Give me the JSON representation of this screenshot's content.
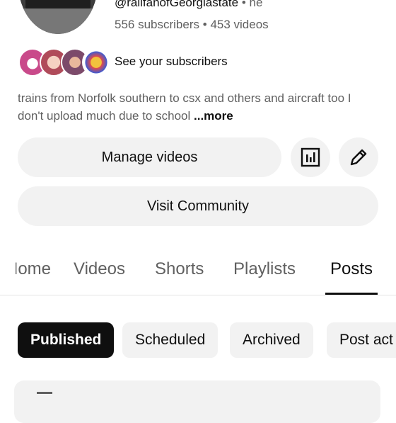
{
  "channel": {
    "handle": "@railfanofGeorgiastate",
    "handle_suffix": "he",
    "subscribers": "556 subscribers",
    "videos": "453 videos",
    "stats_separator": "•"
  },
  "subscribers_link": "See your subscribers",
  "description": {
    "text": "trains from Norfolk southern to csx and others and aircraft too I don't upload much due to school",
    "more_label": "...more"
  },
  "buttons": {
    "manage_videos": "Manage videos",
    "visit_community": "Visit Community"
  },
  "tabs": [
    {
      "label": "Home"
    },
    {
      "label": "Videos"
    },
    {
      "label": "Shorts"
    },
    {
      "label": "Playlists"
    },
    {
      "label": "Posts",
      "selected": true
    }
  ],
  "chips": [
    {
      "label": "Published",
      "selected": true
    },
    {
      "label": "Scheduled"
    },
    {
      "label": "Archived"
    },
    {
      "label": "Post act"
    }
  ],
  "colors": {
    "text_primary": "#0f0f0f",
    "text_secondary": "#606060",
    "surface": "#f2f2f2"
  }
}
